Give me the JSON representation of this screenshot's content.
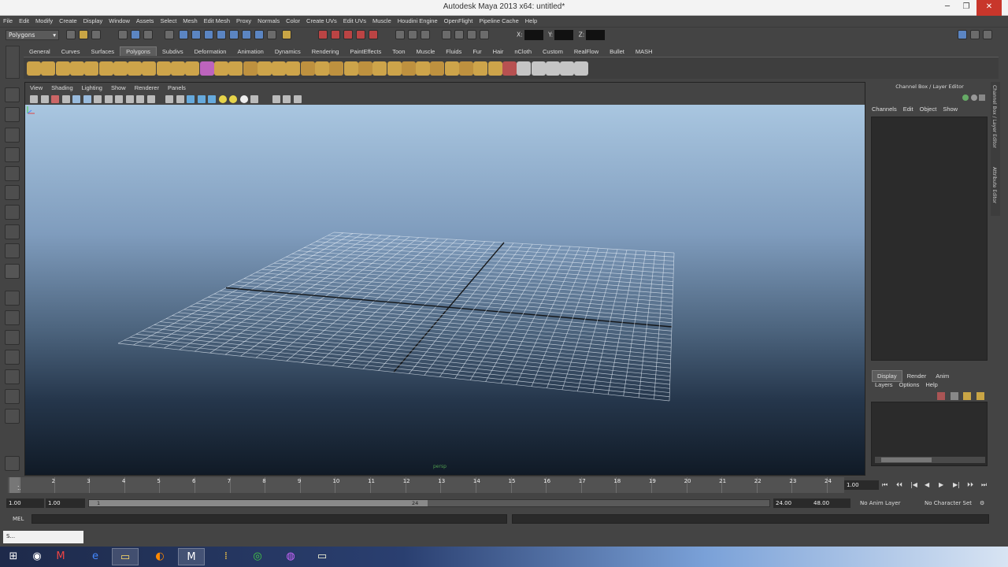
{
  "window": {
    "title": "Autodesk Maya 2013 x64: untitled*",
    "minimize": "─",
    "maximize": "❐",
    "close": "✕"
  },
  "menubar": [
    "File",
    "Edit",
    "Modify",
    "Create",
    "Display",
    "Window",
    "Assets",
    "Select",
    "Mesh",
    "Edit Mesh",
    "Proxy",
    "Normals",
    "Color",
    "Create UVs",
    "Edit UVs",
    "Muscle",
    "Houdini Engine",
    "OpenFlight",
    "Pipeline Cache",
    "Help"
  ],
  "statusline": {
    "mode": "Polygons",
    "mode_arrow": "▾",
    "x_label": "X:",
    "y_label": "Y:",
    "z_label": "Z:"
  },
  "shelf_tabs": [
    "General",
    "Curves",
    "Surfaces",
    "Polygons",
    "Subdivs",
    "Deformation",
    "Animation",
    "Dynamics",
    "Rendering",
    "PaintEffects",
    "Toon",
    "Muscle",
    "Fluids",
    "Fur",
    "Hair",
    "nCloth",
    "Custom",
    "RealFlow",
    "Bullet",
    "MASH"
  ],
  "shelf_active": "Polygons",
  "viewport_menu": [
    "View",
    "Shading",
    "Lighting",
    "Show",
    "Renderer",
    "Panels"
  ],
  "camera_label": "persp",
  "channel_box": {
    "title": "Channel Box / Layer Editor",
    "menu": [
      "Channels",
      "Edit",
      "Object",
      "Show"
    ],
    "layer_tabs": [
      "Display",
      "Render",
      "Anim"
    ],
    "layer_menu": [
      "Layers",
      "Options",
      "Help"
    ],
    "side_tabs": [
      "Channel Box / Layer Editor",
      "Attribute Editor"
    ]
  },
  "timeslider": {
    "ticks": [
      "1",
      "2",
      "3",
      "4",
      "5",
      "6",
      "7",
      "8",
      "9",
      "10",
      "11",
      "12",
      "13",
      "14",
      "15",
      "16",
      "17",
      "18",
      "19",
      "20",
      "21",
      "22",
      "23",
      "24"
    ],
    "current_frame": "1",
    "current_value": "1.00"
  },
  "playback_icons": [
    "⏮",
    "⏴⏴",
    "|◀",
    "◀",
    "▶",
    "▶|",
    "⏵⏵",
    "⏭"
  ],
  "range": {
    "start_time": "1.00",
    "playback_start": "1.00",
    "range_left": "1",
    "range_right": "24",
    "playback_end": "24.00",
    "end_time": "48.00",
    "anim_layer": "No Anim Layer",
    "character_set": "No Character Set"
  },
  "cmdline": {
    "label": "MEL"
  },
  "minimized_window": {
    "label": "S..."
  },
  "colors": {
    "maya_bg": "#444444",
    "sky_top": "#a9c6e0",
    "sky_bottom": "#101a26",
    "close_red": "#c8362b"
  }
}
